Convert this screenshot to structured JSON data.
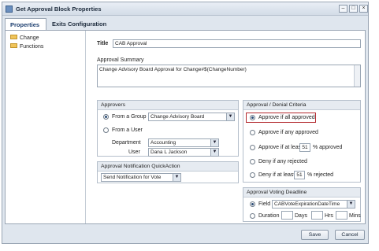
{
  "window": {
    "title": "Get Approval Block Properties"
  },
  "tabs": [
    {
      "label": "Properties",
      "active": true
    },
    {
      "label": "Exits Configuration",
      "active": false
    }
  ],
  "tree": {
    "items": [
      {
        "label": "Change",
        "icon": "folder-icon"
      },
      {
        "label": "Functions",
        "icon": "folder-icon"
      }
    ]
  },
  "form": {
    "title_label": "Title",
    "title_value": "CAB Approval",
    "summary_label": "Approval Summary",
    "summary_value": "Change Advisory Board Approval for Change#$(ChangeNumber)"
  },
  "approvers": {
    "header": "Approvers",
    "from_group_label": "From a Group",
    "from_group_value": "Change Advisory Board",
    "from_user_label": "From a User",
    "department_label": "Department",
    "department_value": "Accounting",
    "user_label": "User",
    "user_value": "Dana L Jackson",
    "selected": "From a Group"
  },
  "notification": {
    "header": "Approval Notification QuickAction",
    "value": "Send Notification for Vote"
  },
  "criteria": {
    "header": "Approval / Denial Criteria",
    "options": {
      "all_approved": "Approve if all approved",
      "any_approved": "Approve if any approved",
      "at_least_prefix": "Approve if at least",
      "at_least_value": "51",
      "at_least_suffix": "% approved",
      "any_rejected": "Deny if any rejected",
      "deny_at_least_prefix": "Deny if at least",
      "deny_at_least_value": "51",
      "deny_at_least_suffix": "% rejected"
    },
    "selected": "Approve if all approved",
    "highlight_color": "#b3292e"
  },
  "deadline": {
    "header": "Approval Voting Deadline",
    "field_label": "Field",
    "field_value": "CABVoteExpirationDateTime",
    "duration_label": "Duration",
    "days_label": "Days",
    "hrs_label": "Hrs",
    "mins_label": "Mins",
    "selected": "Field"
  },
  "footer": {
    "save_label": "Save",
    "cancel_label": "Cancel"
  },
  "colors": {
    "accent": "#2b4b75",
    "panel_bg": "#dfe6ee"
  }
}
